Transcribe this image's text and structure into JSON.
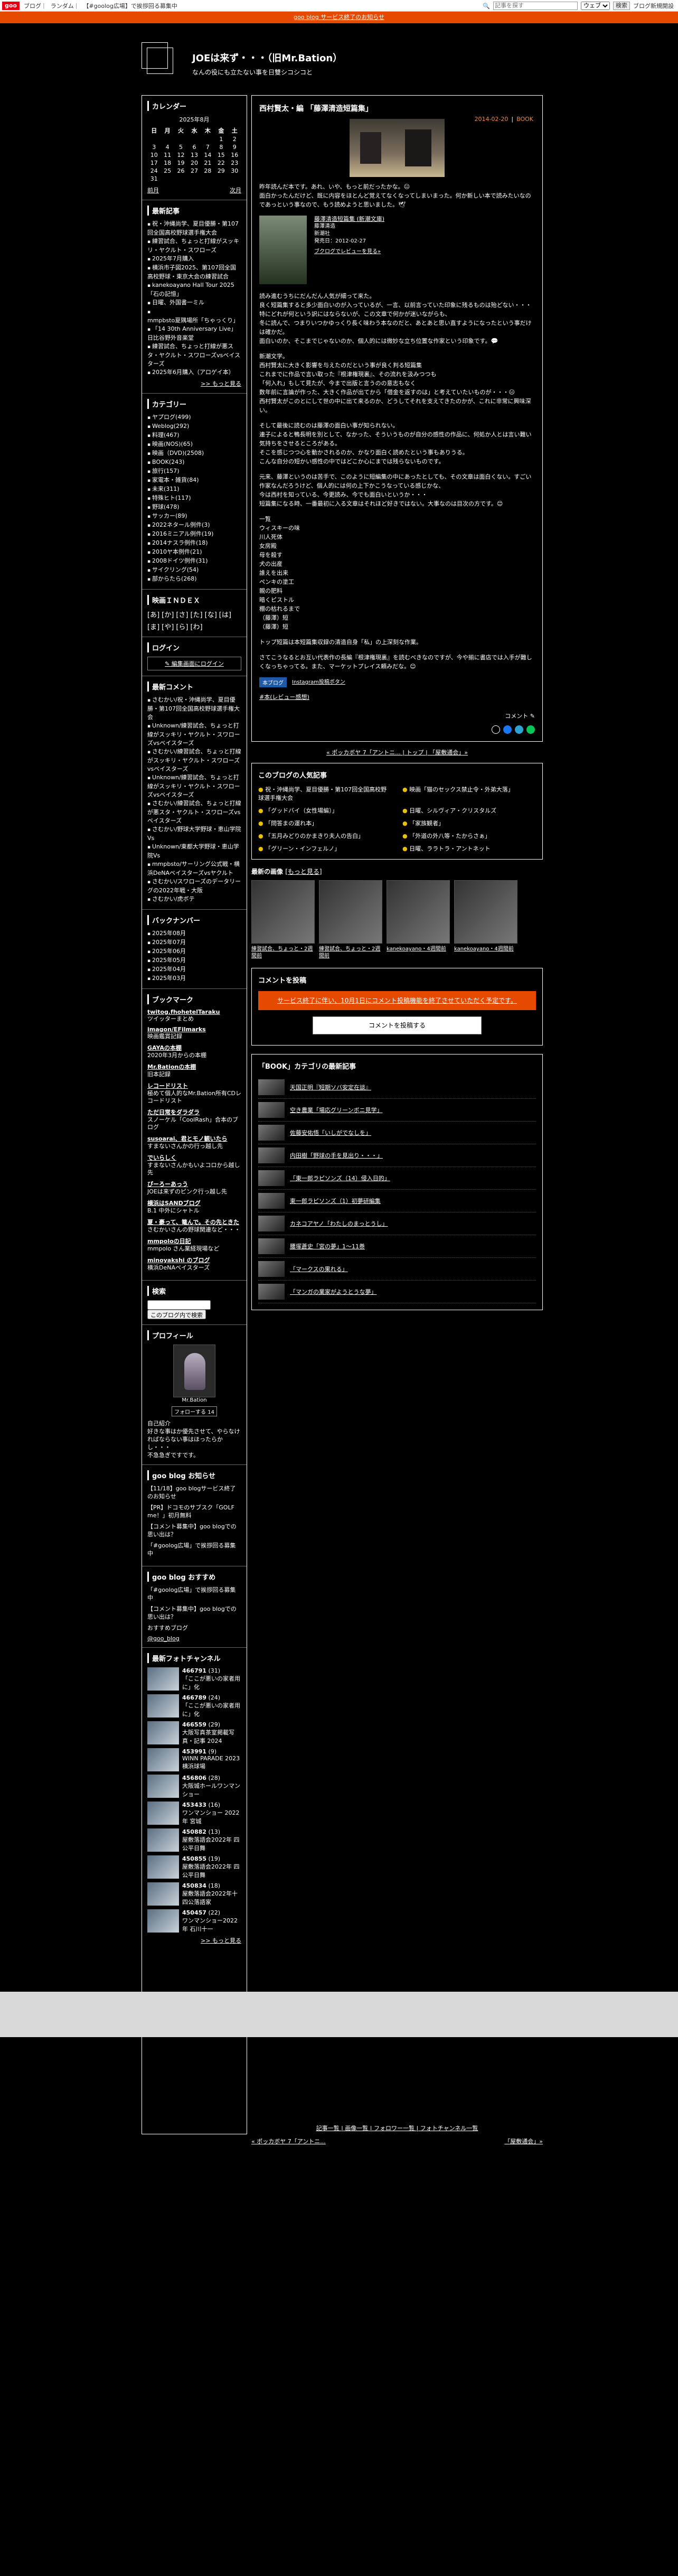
{
  "topbar": {
    "logo": "goo",
    "links": [
      "ブログ",
      "ランダム",
      "【#goolog広場】で挨拶回る募集中"
    ],
    "search_placeholder": "記事を探す",
    "scope": "ウェブ",
    "search_button": "検索",
    "user_link": "ブログ新規開設"
  },
  "banner": "goo blog サービス終了のお知らせ",
  "header": {
    "title": "JOEは来ず・・・（旧Mr.Bation）",
    "description": "なんの役にも立たない事を日雙シコシコと"
  },
  "sidebar": {
    "calendar": {
      "title": "カレンダー",
      "month": "2025年8月",
      "days": [
        "日",
        "月",
        "火",
        "水",
        "木",
        "金",
        "土"
      ],
      "weeks": [
        [
          "",
          "",
          "",
          "",
          "",
          "1",
          "2"
        ],
        [
          "3",
          "4",
          "5",
          "6",
          "7",
          "8",
          "9"
        ],
        [
          "10",
          "11",
          "12",
          "13",
          "14",
          "15",
          "16"
        ],
        [
          "17",
          "18",
          "19",
          "20",
          "21",
          "22",
          "23"
        ],
        [
          "24",
          "25",
          "26",
          "27",
          "28",
          "29",
          "30"
        ],
        [
          "31",
          "",
          "",
          "",
          "",
          "",
          ""
        ]
      ],
      "prev": "前月",
      "next": "次月"
    },
    "recent": {
      "title": "最新記事",
      "items": [
        "祝・沖縄尚学、夏目優勝・第107回全国高校野球選手権大会",
        "練習試合、ちょっと打線がスッキリ・ヤクルト・スワローズ",
        "2025年7月購入",
        "横浜市子図2025、第107回全国高校野球・東京大会の練習試合",
        "kanekoayano Hall Tour 2025「石の記憶」",
        "日曜、外国書一ミル",
        "mmpbsto夏隅場所「ちゃっくり」",
        "「14 30th Anniversary Live」日比谷野外音楽堂",
        "練習試合、ちょっと打線が悪スタ・ヤクルト・スワローズvsベイスターズ",
        "2025年6月購入（アロゲイ本）"
      ],
      "more": ">> もっと見る"
    },
    "categories": {
      "title": "カテゴリー",
      "items": [
        "ヤプログ(499)",
        "Weblog(292)",
        "料理(467)",
        "映画(NOS)(65)",
        "映画（DVD)(2508)",
        "BOOK(243)",
        "旅行(157)",
        "家電本・雑貨(84)",
        "未来(311)",
        "特殊ヒト(117)",
        "野球(478)",
        "サッカー(89)",
        "2022ネタール例件(3)",
        "2016ミニアル例件(19)",
        "2014ナスラ例件(18)",
        "2010ヤ本例件(21)",
        "2008ドイツ例件(31)",
        "サイクリング(54)",
        "部からたら(268)"
      ]
    },
    "index": {
      "title": "映画ＩＮＤＥＸ",
      "items": [
        "[あ]",
        "[か]",
        "[さ]",
        "[た]",
        "[な]",
        "[は]",
        "[ま]",
        "[や]",
        "[ら]",
        "[わ]"
      ]
    },
    "login": {
      "title": "ログイン",
      "button": "編集画面にログイン"
    },
    "comments": {
      "title": "最新コメント",
      "items": [
        "さむかい/祝・沖縄尚学、夏目優勝・第107回全国高校野球選手権大会",
        "Unknown/練習試合、ちょっと打線がスッキリ・ヤクルト・スワローズvsベイスターズ",
        "さむかい/練習試合、ちょっと打線がスッキリ・ヤクルト・スワローズvsベイスターズ",
        "Unknown/練習試合、ちょっと打線がスッキリ・ヤクルト・スワローズvsベイスターズ",
        "さむかい/練習試合、ちょっと打線が悪スタ・ヤクルト・スワローズvsベイスターズ",
        "さむかい/野球大学野球・恵山学院Vs",
        "Unknown/東都大学野球・恵山学院Vs",
        "mmpbsto/サーリング公式戦・横浜DeNAベイスターズvsヤクルト",
        "さむかい/スワローズのデータリーグの2022年戦・大阪",
        "さむかい/虎ボテ"
      ]
    },
    "backnumber": {
      "title": "バックナンバー",
      "items": [
        "2025年08月",
        "2025年07月",
        "2025年06月",
        "2025年05月",
        "2025年04月",
        "2025年03月"
      ]
    },
    "bookmarks": {
      "title": "ブックマーク",
      "items": [
        {
          "name": "twitog.fhohetelTaraku",
          "desc": "ツイッターまとめ"
        },
        {
          "name": "imagon/EFilmarks",
          "desc": "映画鑑賞記録"
        },
        {
          "name": "GAYAの本棚",
          "desc": "2020年3月からの本棚"
        },
        {
          "name": "Mr.Bationの本棚",
          "desc": "旧本記録"
        },
        {
          "name": "レコードリスト",
          "desc": "極めて個人的なMr.Bation所有CDレコードリスト"
        },
        {
          "name": "ただ日常をダラダラ",
          "desc": "スノーケル「CoolRash」合本のブログ"
        },
        {
          "name": "susoarai、君とモノ観いたら",
          "desc": "すまないさんかの行っ越し先"
        },
        {
          "name": "でいらしく",
          "desc": "すまないさんかもいよコロから越し先"
        },
        {
          "name": "ぴーろーあっう",
          "desc": "JOEは来ずのピンク行っ越し先"
        },
        {
          "name": "横浜はSANDブログ",
          "desc": "B.1 中外にシャトル"
        },
        {
          "name": "夏・豪って、篭んで。その先ときた",
          "desc": "さむかいさんの野球関連など・・・"
        },
        {
          "name": "mmpoloの日記",
          "desc": "mmpolo さん業経現場など"
        },
        {
          "name": "minoyakshi のブログ",
          "desc": "横浜DeNAベイスターズ"
        }
      ]
    },
    "search": {
      "title": "検索",
      "placeholder": "",
      "button": "このブログ内で検索"
    },
    "profile": {
      "title": "プロフィール",
      "image_label": "Mr.Bation",
      "follow": "フォローする",
      "follow_count": "14",
      "lines": [
        "自己紹介",
        "好きな事はか優先させて、やらなければならない事はほったらかし・・・",
        "不急急ぎですです。"
      ]
    },
    "news": {
      "title": "goo blog お知らせ",
      "items": [
        "【11/18】goo blogサービス終了のお知らせ",
        "【PR】ドコモのサブスク「GOLF me！」初月無料",
        "【コメント募集中】goo blogでの思い出は？",
        "「#goolog広場」で挨拶回る募集中"
      ]
    },
    "recommend": {
      "title": "goo blog おすすめ",
      "items": [
        "「#goolog広場」で挨拶回る募集中",
        "【コメント募集中】goo blogでの思い出は？",
        "おすすめブログ"
      ],
      "twitter": "@goo_blog"
    },
    "photos": {
      "title": "最新フォトチャンネル",
      "items": [
        {
          "id": "466791",
          "count": "(31)",
          "text": "「ここが悪いの家者用に」化"
        },
        {
          "id": "466789",
          "count": "(24)",
          "text": "「ここが悪いの家者用に」化"
        },
        {
          "id": "466559",
          "count": "(29)",
          "text": "大阪写真茶室掲載写真・記事 2024"
        },
        {
          "id": "453991",
          "count": "(9)",
          "text": "WINN PARADE 2023 横浜球場"
        },
        {
          "id": "456806",
          "count": "(28)",
          "text": "大阪城ホールワンマンショー"
        },
        {
          "id": "453433",
          "count": "(16)",
          "text": "ワンマンショー 2022年 宮城"
        },
        {
          "id": "450882",
          "count": "(13)",
          "text": "屋敷落語会2022年 四公平日舞"
        },
        {
          "id": "450855",
          "count": "(19)",
          "text": "屋敷落語会2022年 四公平日舞"
        },
        {
          "id": "450834",
          "count": "(18)",
          "text": "屋敷落語会2022年十四公落語家"
        },
        {
          "id": "450457",
          "count": "(22)",
          "text": "ワンマンショー2022年 石川十一"
        }
      ],
      "more": ">> もっと見る"
    }
  },
  "post": {
    "title": "西村賢太・編 「藤澤清造短篇集」",
    "date": "2014-02-20",
    "category": "BOOK",
    "intro": "昨年読んだ本です。あれ、いや、もっと前だったかな。😐\n面白かったんだけど、既に内容をほとんど覚えてなくなってしまいまった。何か新しい本で読みたいなのであっという事なので、もう読めようと思いました。🕊",
    "book": {
      "title": "藤澤清造短篇集 (新潮文庫)",
      "author": "藤澤清造",
      "publisher": "新潮社",
      "date": "発売日：2012-02-27",
      "link": "ブクログでレビューを見る»"
    },
    "p1": "読み進むうちにだんだん人気が細って来た。\n良く短篇集すると多少面白いのが入っているが、一言、以前言っていた印象に残るものは殆どない・・・\n特にどれが何という訳にはならないが、この文章で何かが迷いながらも、\n冬に読んで、つまりいつかゆっくり長く味わう本なのだと、あとあと思い直すようになったという事だけは確かだ。\n面白いのか、そこまでじゃないのか、個人的には微妙な立ち位置な作家という印象です。💬",
    "p2": "新潮文学。\n西村賢太に大きく影響を与えたのだという事が良く判る短篇集\nこれまでに作品で言い取った『根津権現裏』、その流れを汲みつつも\n「何入れ」もして見たが、今まで出版と言うのの意志もなく\n数年前に言論が作った、大きく作品が出てから「借金を返すのは」と考えていたいものが・・・😐\n西村賢太がこのとにして世の中に出て来るのか、どうしてそれを支えてきたのかが、これに非常に興味深い。",
    "p3": "そして最後に読むのは藤澤の面白い事が知られない。\n連子によると鴨長明を別として、なかった、そういうものが自分の感性の作品に、何処か人とは言い難い気持ちをさせるところがある。\nそこを感じつつ心を動かされるのか、かなり面白く読めたという事もありうる。\nこんな自分の短かい感性の中ではどこか心にまでは残らないものです。",
    "p4": "元来、藤澤というのは苦手で、このように短編集の中にあったとしても、その文章は面白くない。すごい作家なんだろうけど、個人的には何の上下かこうなっている感じかな、\n今は西村を知っている、今更読み、今でも面白いというか・・・\n短篇集になる時、一番最初に入る文章はそれほど好きではない。大事なのは目次の方です。😊",
    "list_title": "一覧",
    "list": [
      "ウィスキーの味",
      "川人死体",
      "女房殿",
      "母を殺す",
      "犬の出産",
      "誰えを出来",
      "ペンキの塗工",
      "親の肥料",
      "暗くピストル",
      "棚の枯れるまで",
      "（藤澤）短",
      "（藤澤）短"
    ],
    "p5": "トップ短篇は本短篇集収録の清造自身「私」の上深刻な作業。",
    "p6": "さてこうなるとお互い代表作の長編『根津権現裏』を読むべきなのですが、今や揃に書店では入手が難しくなっちゃってる。また、マーケットプレイス頼みだな。😊",
    "badge1": "本ブログ",
    "badge2": "Instagram投稿ボタン",
    "tag": "#本(レビュー感想)",
    "comment_link": "コメント"
  },
  "nav": {
    "prev": "« ポッカボヤ 7「アントニ...",
    "top": "トップ",
    "next": "「屋敷通会」»"
  },
  "recommend_box": {
    "title": "このブログの人気記事",
    "items": [
      "祝・沖縄尚学、夏目優勝・第107回全国高校野球選手権大会",
      "映画「猫のセックス禁止令・外弟大落」",
      "「グッドバイ（女性場編）」",
      "日曜、シルヴィア・クリスタルズ",
      "「問答まの運れ本」",
      "「家族観者」",
      "「五月みどりのかまきり夫人の告白」",
      "「外道の外八等・たからさぁ」",
      "「グリーン・インフェルノ」",
      "日曜、ララトラ・アントネット"
    ]
  },
  "popular": {
    "title": "最新の画像",
    "more": "[もっと見る]",
    "items": [
      "練習試合、ちょっと・2週間前",
      "練習試合、ちょっと・2週間前",
      "kanekoayano・4週間前",
      "kanekoayano・4週間前"
    ]
  },
  "comment": {
    "title": "コメントを投稿",
    "notice": "サービス終了に伴い、10月1日にコメント投稿機能を終了させていただく予定です。",
    "button": "コメントを投稿する"
  },
  "category_latest": {
    "title": "「BOOK」カテゴリの最新記事",
    "items": [
      "天国正明『短期ソバ安定在談』",
      "空き農業「場応グリーンボニ見学」",
      "佐藤安佑悟「いしがでなしを」",
      "内田樹「野球の手を見出り・・・」",
      "「東一郎ラピソンズ（14）侵入日的」",
      "東一郎ラピソンズ（1）初夢研編集",
      "カネコアヤノ「わたしのまっとうし」",
      "腰塚蒼史「宮の夢」1～11巻",
      "「マークスの果れる」",
      "「マンガの業家がようとうな夢」"
    ]
  },
  "bottom_links": {
    "links": [
      "記事一覧",
      "画像一覧",
      "フォロワー一覧",
      "フォトチャンネル一覧"
    ]
  },
  "bottom_nav": {
    "prev": "« ポッカボヤ 7「アントニ...",
    "next": "「屋敷通会」»"
  }
}
